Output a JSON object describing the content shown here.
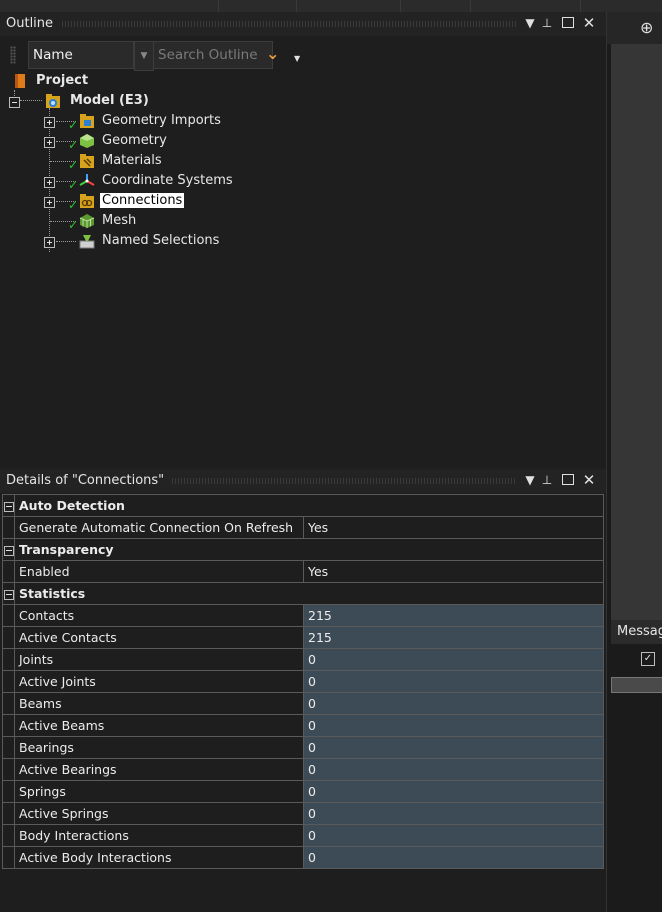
{
  "outline": {
    "title": "Outline",
    "filter_label": "Name",
    "search_placeholder": "Search Outline",
    "tree": [
      {
        "label": "Project",
        "icon": "project-icon",
        "bold": true
      },
      {
        "label": "Model (E3)",
        "icon": "model-icon",
        "bold": true
      },
      {
        "label": "Geometry Imports",
        "icon": "geometry-imports-icon",
        "checked": true
      },
      {
        "label": "Geometry",
        "icon": "geometry-icon",
        "checked": true
      },
      {
        "label": "Materials",
        "icon": "materials-icon",
        "checked": true
      },
      {
        "label": "Coordinate Systems",
        "icon": "coordinate-systems-icon",
        "checked": true
      },
      {
        "label": "Connections",
        "icon": "connections-icon",
        "checked": true,
        "selected": true
      },
      {
        "label": "Mesh",
        "icon": "mesh-icon",
        "checked": true
      },
      {
        "label": "Named Selections",
        "icon": "named-selections-icon"
      }
    ]
  },
  "details": {
    "title": "Details of \"Connections\"",
    "categories": [
      {
        "name": "Auto Detection",
        "rows": [
          {
            "prop": "Generate Automatic Connection On Refresh",
            "value": "Yes"
          }
        ]
      },
      {
        "name": "Transparency",
        "rows": [
          {
            "prop": "Enabled",
            "value": "Yes"
          }
        ]
      },
      {
        "name": "Statistics",
        "rows": [
          {
            "prop": "Contacts",
            "value": "215"
          },
          {
            "prop": "Active Contacts",
            "value": "215"
          },
          {
            "prop": "Joints",
            "value": "0"
          },
          {
            "prop": "Active Joints",
            "value": "0"
          },
          {
            "prop": "Beams",
            "value": "0"
          },
          {
            "prop": "Active Beams",
            "value": "0"
          },
          {
            "prop": "Bearings",
            "value": "0"
          },
          {
            "prop": "Active Bearings",
            "value": "0"
          },
          {
            "prop": "Springs",
            "value": "0"
          },
          {
            "prop": "Active Springs",
            "value": "0"
          },
          {
            "prop": "Body Interactions",
            "value": "0"
          },
          {
            "prop": "Active Body Interactions",
            "value": "0"
          }
        ]
      }
    ]
  },
  "right": {
    "messages_tab": "Messag"
  },
  "colors": {
    "readonly_cell": "#3d4b56",
    "check": "#2fc12f",
    "accent": "#e8a23a"
  }
}
